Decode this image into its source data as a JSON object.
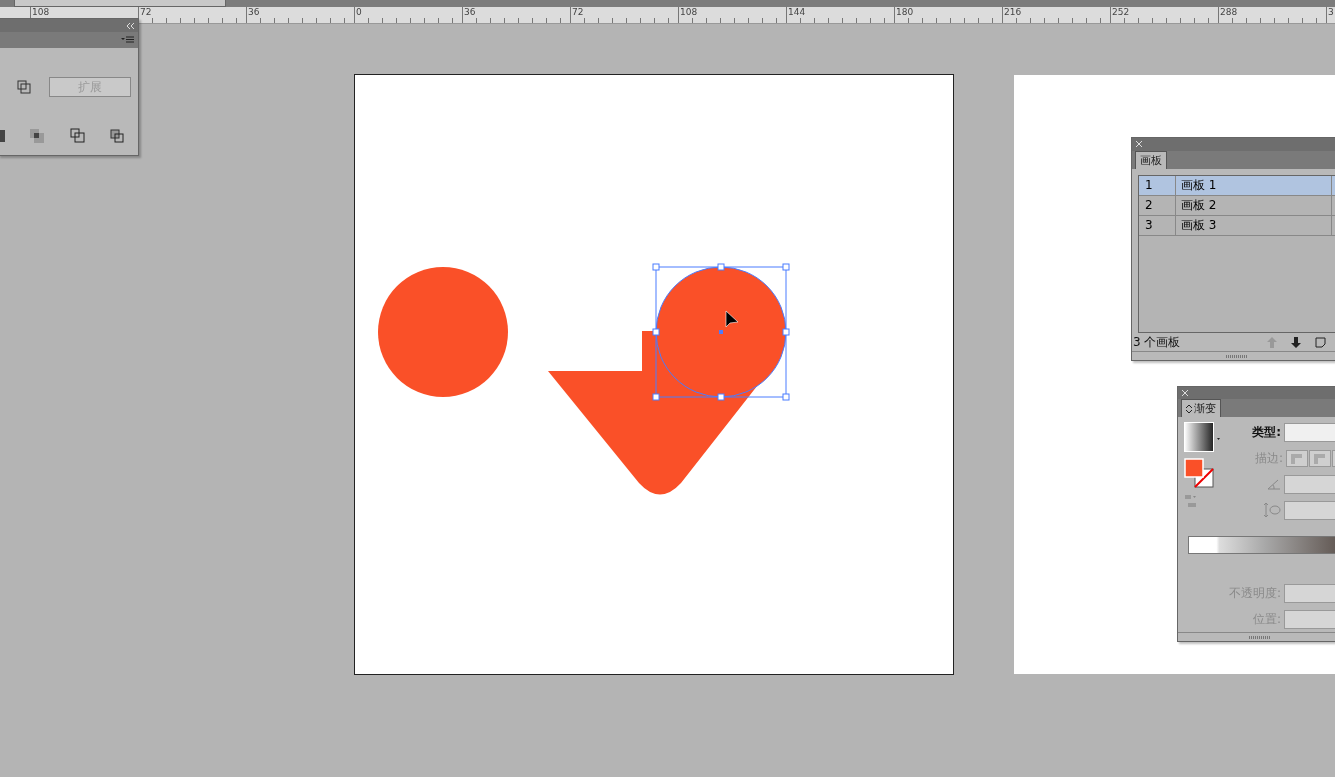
{
  "ruler": {
    "labels": [
      "108",
      "72",
      "36",
      "0",
      "36",
      "72",
      "108",
      "144",
      "180",
      "216",
      "252",
      "288",
      "3"
    ]
  },
  "pathfinder_panel": {
    "expand_button": {
      "label": "扩展",
      "disabled": true
    }
  },
  "canvas": {
    "shapes": [
      {
        "kind": "circle",
        "selected": false
      },
      {
        "kind": "drop",
        "selected": false
      },
      {
        "kind": "circle",
        "selected": true
      }
    ]
  },
  "artboards_panel": {
    "tab": {
      "label": "画板",
      "selected": true
    },
    "rows": [
      {
        "number": "1",
        "name": "画板 1",
        "selected": true
      },
      {
        "number": "2",
        "name": "画板 2",
        "selected": false
      },
      {
        "number": "3",
        "name": "画板 3",
        "selected": false
      }
    ],
    "count": "3 个画板"
  },
  "gradient_panel": {
    "tab": {
      "label": "渐变",
      "selected": true
    },
    "fields": [
      {
        "kind": "type",
        "label": "类型:",
        "disabled": false
      },
      {
        "kind": "stroke",
        "label": "描边:",
        "disabled": true
      },
      {
        "kind": "angle",
        "disabled": true
      },
      {
        "kind": "aspect",
        "disabled": true
      },
      {
        "kind": "opacity",
        "label": "不透明度:",
        "disabled": true
      },
      {
        "kind": "position",
        "label": "位置:",
        "disabled": true
      }
    ]
  }
}
